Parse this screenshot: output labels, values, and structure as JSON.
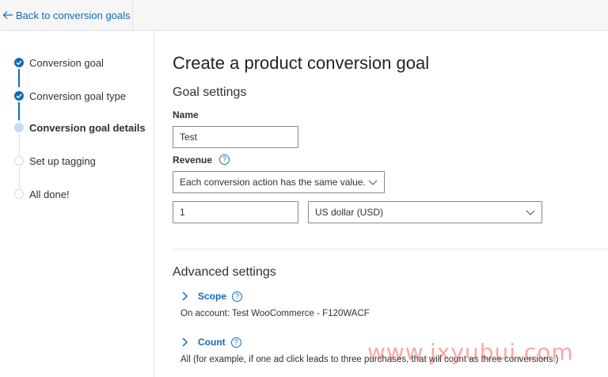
{
  "nav": {
    "back_label": "Back to conversion goals"
  },
  "steps": [
    {
      "label": "Conversion goal",
      "state": "done"
    },
    {
      "label": "Conversion goal type",
      "state": "done"
    },
    {
      "label": "Conversion goal details",
      "state": "current"
    },
    {
      "label": "Set up tagging",
      "state": "todo"
    },
    {
      "label": "All done!",
      "state": "todo"
    }
  ],
  "main": {
    "title": "Create a product conversion goal",
    "goal_settings": "Goal settings",
    "name_label": "Name",
    "name_value": "Test",
    "revenue_label": "Revenue",
    "revenue_help": "?",
    "revenue_type": "Each conversion action has the same value.",
    "revenue_amount": "1",
    "currency": "US dollar (USD)",
    "advanced_settings": "Advanced settings",
    "scope_label": "Scope",
    "scope_help": "?",
    "scope_text": "On account: Test WooCommerce - F120WACF",
    "count_label": "Count",
    "count_help": "?",
    "count_text": "All (for example, if one ad click leads to three purchases, that will count as three conversions.)"
  },
  "watermark": "www.jxyubui.com",
  "colors": {
    "accent": "#0f6cbd",
    "current_step": "#c7dcf1",
    "border": "#8a8886"
  }
}
